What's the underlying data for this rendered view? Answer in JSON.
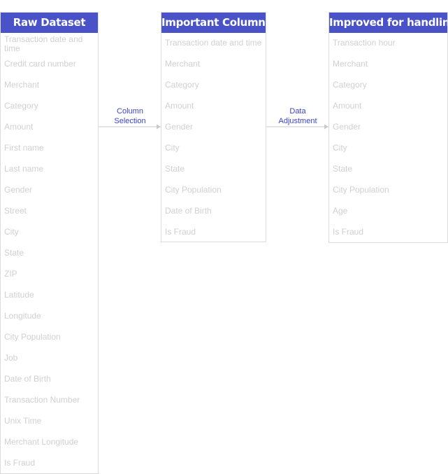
{
  "tables": [
    {
      "title": "Raw Dataset",
      "rows": [
        "Transaction date and time",
        "Credit card number",
        "Merchant",
        "Category",
        "Amount",
        "First name",
        "Last name",
        "Gender",
        "Street",
        "City",
        "State",
        "ZIP",
        "Latitude",
        "Longitude",
        "City Population",
        "Job",
        "Date of Birth",
        "Transaction Number",
        "Unix Time",
        "Merchant Longitude",
        "Is Fraud"
      ]
    },
    {
      "title": "Important Columns",
      "rows": [
        "Transaction date and time",
        "Merchant",
        "Category",
        "Amount",
        "Gender",
        "City",
        "State",
        "City Population",
        "Date of Birth",
        "Is Fraud"
      ]
    },
    {
      "title": "Improved for handling",
      "rows": [
        "Transaction hour",
        "Merchant",
        "Category",
        "Amount",
        "Gender",
        "City",
        "State",
        "City Population",
        "Age",
        "Is Fraud"
      ]
    }
  ],
  "edges": [
    {
      "label": "Column Selection"
    },
    {
      "label": "Data Adjustment"
    }
  ],
  "colors": {
    "header": "#4a52c8",
    "edge_label": "#3a44c8",
    "edge_line": "#c8c8c8",
    "row_text": "#d0d0d0"
  }
}
